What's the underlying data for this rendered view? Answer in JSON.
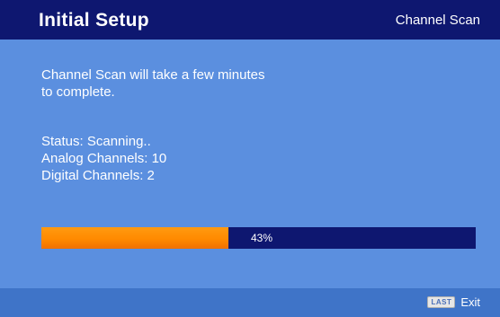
{
  "header": {
    "title": "Initial  Setup",
    "subtitle": "Channel Scan"
  },
  "message": {
    "line1": "Channel Scan will take a few minutes",
    "line2": "to complete."
  },
  "status": {
    "status_line": "Status: Scanning..",
    "analog_line": "Analog Channels: 10",
    "digital_line": "Digital Channels: 2"
  },
  "progress": {
    "label": "43%",
    "percent": 43
  },
  "footer": {
    "key_label": "LAST",
    "exit_label": "Exit"
  },
  "colors": {
    "header_bg": "#0e1770",
    "body_bg": "#5b8fdf",
    "progress_fill": "#ff8a00",
    "progress_track": "#0e1770"
  }
}
